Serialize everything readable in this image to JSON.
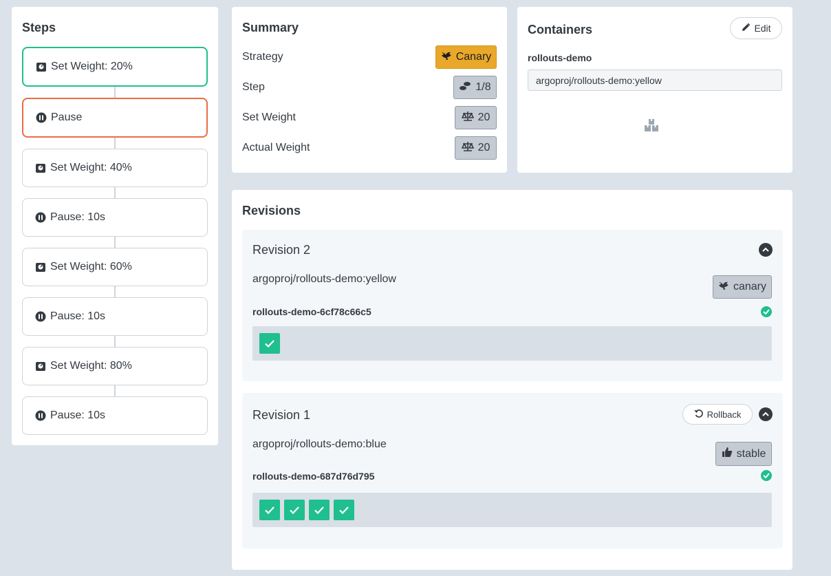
{
  "steps": {
    "title": "Steps",
    "items": [
      {
        "label": "Set Weight: 20%",
        "icon": "weight-icon",
        "state": "completed"
      },
      {
        "label": "Pause",
        "icon": "pause-icon",
        "state": "current"
      },
      {
        "label": "Set Weight: 40%",
        "icon": "weight-icon",
        "state": "pending"
      },
      {
        "label": "Pause: 10s",
        "icon": "pause-icon",
        "state": "pending"
      },
      {
        "label": "Set Weight: 60%",
        "icon": "weight-icon",
        "state": "pending"
      },
      {
        "label": "Pause: 10s",
        "icon": "pause-icon",
        "state": "pending"
      },
      {
        "label": "Set Weight: 80%",
        "icon": "weight-icon",
        "state": "pending"
      },
      {
        "label": "Pause: 10s",
        "icon": "pause-icon",
        "state": "pending"
      }
    ]
  },
  "summary": {
    "title": "Summary",
    "rows": [
      {
        "label": "Strategy",
        "value": "Canary",
        "icon": "canary-bird-icon"
      },
      {
        "label": "Step",
        "value": "1/8",
        "icon": "footsteps-icon"
      },
      {
        "label": "Set Weight",
        "value": "20",
        "icon": "balance-scale-icon"
      },
      {
        "label": "Actual Weight",
        "value": "20",
        "icon": "balance-scale-icon"
      }
    ]
  },
  "containers": {
    "title": "Containers",
    "edit_label": "Edit",
    "name": "rollouts-demo",
    "image": "argoproj/rollouts-demo:yellow"
  },
  "revisions": {
    "title": "Revisions",
    "items": [
      {
        "title": "Revision 2",
        "image": "argoproj/rollouts-demo:yellow",
        "badge": "canary",
        "replicaset": "rollouts-demo-6cf78c66c5",
        "pods": 1
      },
      {
        "title": "Revision 1",
        "rollback_label": "Rollback",
        "image": "argoproj/rollouts-demo:blue",
        "badge": "stable",
        "replicaset": "rollouts-demo-687d76d795",
        "pods": 4
      }
    ]
  },
  "colors": {
    "page_bg": "#dce2e9",
    "success": "#1fbf8f",
    "current": "#e96d43",
    "canary": "#e9a829"
  }
}
